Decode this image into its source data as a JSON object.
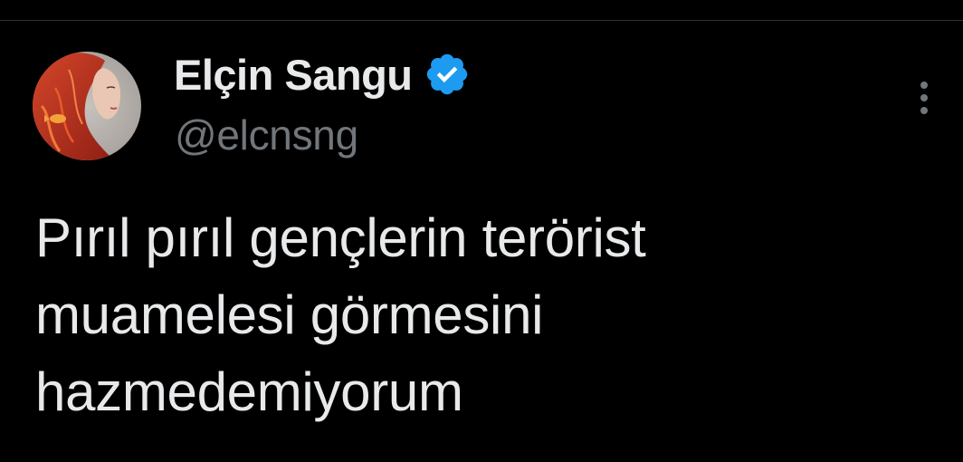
{
  "author": {
    "display_name": "Elçin Sangu",
    "handle": "@elcnsng",
    "verified": true
  },
  "tweet": {
    "lines": [
      "Pırıl pırıl gençlerin terörist",
      "muamelesi görmesini",
      "hazmedemiyorum"
    ]
  },
  "icons": {
    "verified": "verified-badge-icon",
    "more": "more-options-icon"
  },
  "colors": {
    "background": "#000000",
    "primary_text": "#e7e9ea",
    "secondary_text": "#71767b",
    "verified_blue": "#1d9bf0",
    "divider": "#2f3336"
  }
}
